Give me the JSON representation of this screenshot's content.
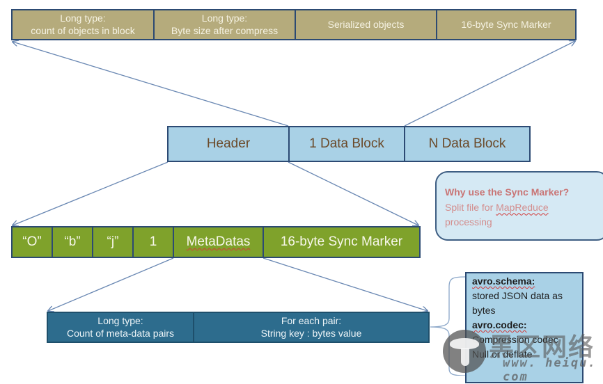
{
  "diagram": {
    "block_row": {
      "cells": [
        {
          "line1": "Long type:",
          "line2": "count of objects in block"
        },
        {
          "line1": "Long type:",
          "line2": "Byte size after compress"
        },
        {
          "line1": "Serialized objects",
          "line2": ""
        },
        {
          "line1": "16-byte Sync Marker",
          "line2": ""
        }
      ]
    },
    "file_row": {
      "cells": [
        "Header",
        "1 Data Block",
        "N Data Block"
      ]
    },
    "header_row": {
      "cells": [
        "“O”",
        "“b”",
        "“j”",
        "1",
        "MetaDatas",
        "16-byte Sync Marker"
      ]
    },
    "meta_row": {
      "cells": [
        {
          "line1": "Long type:",
          "line2": "Count of meta-data pairs"
        },
        {
          "line1": "For each pair:",
          "line2": "String key :  bytes value"
        }
      ]
    },
    "callout": {
      "question": "Why use the Sync Marker?",
      "answer_prefix": "Split file for ",
      "answer_keyword": "MapReduce",
      "answer_suffix": "processing"
    },
    "meta_box": {
      "schema_key": "avro.schema:",
      "schema_desc": "stored JSON data as bytes",
      "codec_key": "avro.codec:",
      "codec_desc1": "Compression codec",
      "codec_desc2": "Null or deflate"
    },
    "watermark": {
      "name": "黑区网络",
      "url": "www. heiqu. com",
      "icon": "mushroom-logo-icon"
    }
  },
  "colors": {
    "block_fill": "#b5ab7c",
    "file_fill": "#a9d1e6",
    "header_fill": "#7fa22b",
    "meta_fill": "#2d6c8d",
    "callout_fill": "#d5e9f4",
    "callout_text": "#c97575",
    "border": "#2c4a73",
    "arrow": "#6a88b3"
  }
}
